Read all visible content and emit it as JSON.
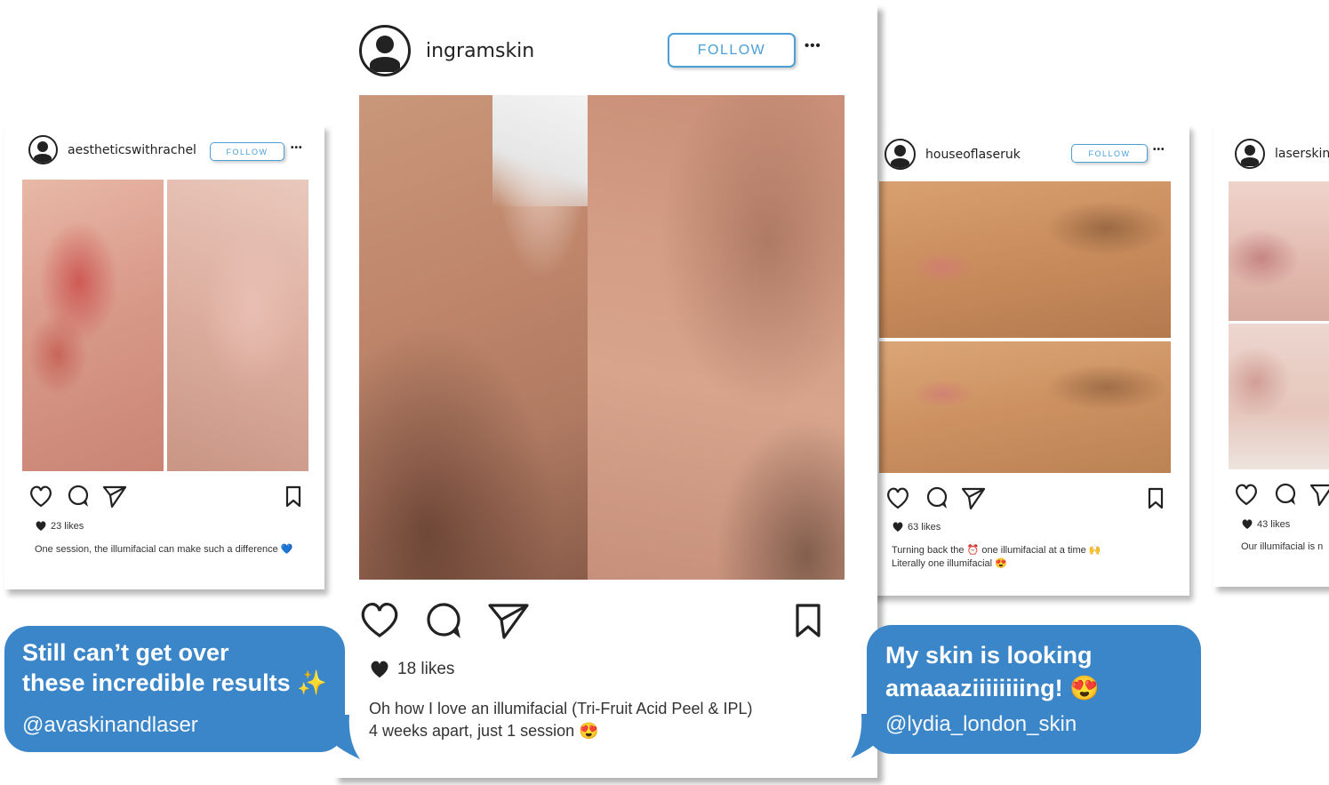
{
  "posts": [
    {
      "username": "aestheticswithrachel",
      "follow_label": "FOLLOW",
      "more_label": "•••",
      "likes": "23 likes",
      "caption": "One session, the illumifacial can make such a difference 💙"
    },
    {
      "username": "ingramskin",
      "follow_label": "FOLLOW",
      "more_label": "•••",
      "likes": "18 likes",
      "caption_line1": "Oh how I love an illumifacial (Tri-Fruit Acid Peel & IPL)",
      "caption_line2": "4 weeks apart, just 1 session 😍"
    },
    {
      "username": "houseoflaseruk",
      "follow_label": "FOLLOW",
      "more_label": "•••",
      "likes": "63 likes",
      "caption_line1": "Turning back the ⏰ one illumifacial at a time 🙌",
      "caption_line2": "Literally one illumifacial 😍"
    },
    {
      "username": "laserskins",
      "likes": "43 likes",
      "caption": "Our illumifacial is n"
    }
  ],
  "testimonials": [
    {
      "quote_line1": "Still can’t get over",
      "quote_line2": "these incredible results ✨",
      "handle": "@avaskinandlaser"
    },
    {
      "quote_line1": "My skin is looking",
      "quote_line2": "amaaaziiiiiiiing! 😍",
      "handle": "@lydia_london_skin"
    }
  ],
  "icons": [
    "user-avatar-icon",
    "heart-icon",
    "comment-icon",
    "share-icon",
    "bookmark-icon",
    "heart-filled-icon"
  ],
  "colors": {
    "accent": "#4a9fd6",
    "bubble": "#3b86c8",
    "text": "#222222"
  }
}
